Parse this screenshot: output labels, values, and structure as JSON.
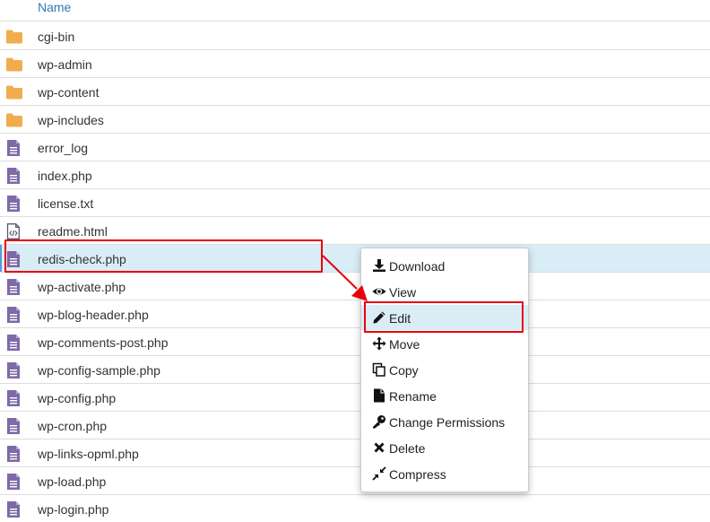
{
  "header": {
    "name_label": "Name"
  },
  "files": [
    {
      "name": "cgi-bin",
      "type": "folder"
    },
    {
      "name": "wp-admin",
      "type": "folder"
    },
    {
      "name": "wp-content",
      "type": "folder"
    },
    {
      "name": "wp-includes",
      "type": "folder"
    },
    {
      "name": "error_log",
      "type": "text"
    },
    {
      "name": "index.php",
      "type": "text"
    },
    {
      "name": "license.txt",
      "type": "text"
    },
    {
      "name": "readme.html",
      "type": "html"
    },
    {
      "name": "redis-check.php",
      "type": "text"
    },
    {
      "name": "wp-activate.php",
      "type": "text"
    },
    {
      "name": "wp-blog-header.php",
      "type": "text"
    },
    {
      "name": "wp-comments-post.php",
      "type": "text"
    },
    {
      "name": "wp-config-sample.php",
      "type": "text"
    },
    {
      "name": "wp-config.php",
      "type": "text"
    },
    {
      "name": "wp-cron.php",
      "type": "text"
    },
    {
      "name": "wp-links-opml.php",
      "type": "text"
    },
    {
      "name": "wp-load.php",
      "type": "text"
    },
    {
      "name": "wp-login.php",
      "type": "text"
    }
  ],
  "menu": {
    "items": [
      {
        "label": "Download",
        "icon": "download-icon"
      },
      {
        "label": "View",
        "icon": "eye-icon"
      },
      {
        "label": "Edit",
        "icon": "pencil-icon"
      },
      {
        "label": "Move",
        "icon": "move-icon"
      },
      {
        "label": "Copy",
        "icon": "copy-icon"
      },
      {
        "label": "Rename",
        "icon": "file-icon"
      },
      {
        "label": "Change Permissions",
        "icon": "key-icon"
      },
      {
        "label": "Delete",
        "icon": "x-icon"
      },
      {
        "label": "Compress",
        "icon": "compress-icon"
      }
    ]
  },
  "colors": {
    "folder": "#f0ad4e",
    "file": "#7e6aa8",
    "selected_row": "#d9edf7",
    "annotation": "#e8000b",
    "link": "#337ab7"
  }
}
